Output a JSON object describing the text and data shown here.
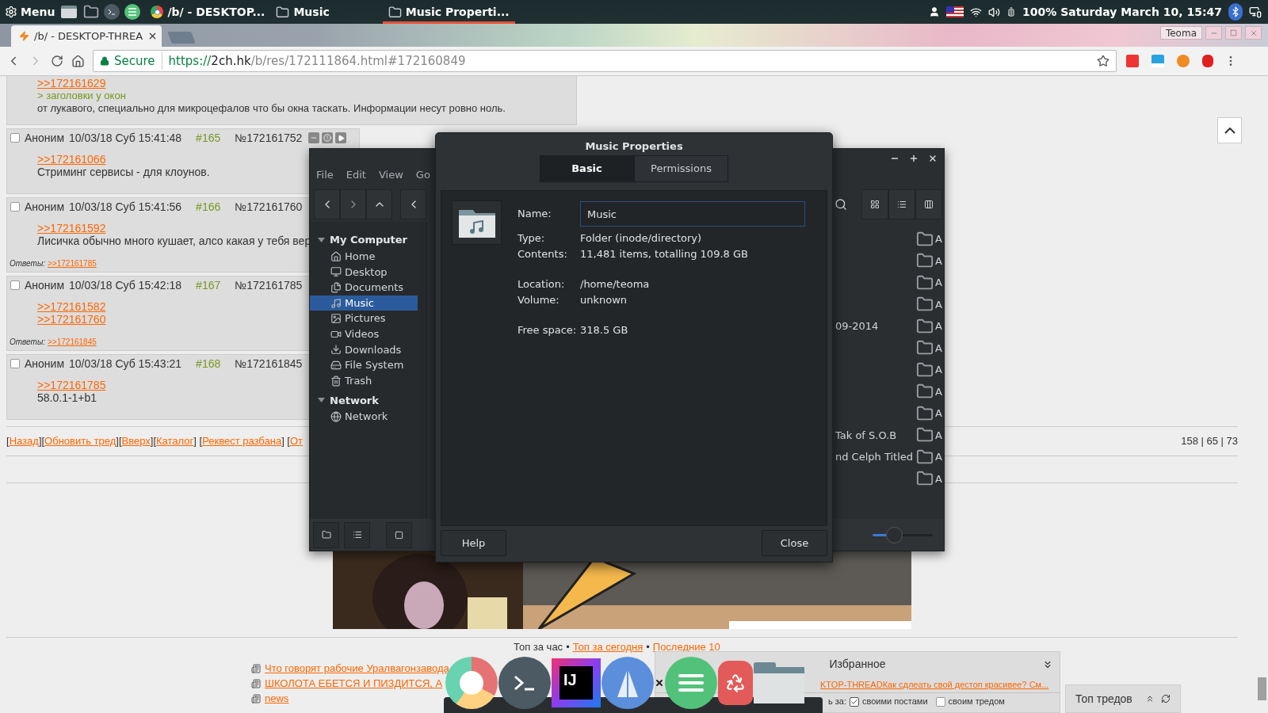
{
  "panel": {
    "menu_label": "Menu",
    "tasks": [
      {
        "label": "/b/ - DESKTOP...",
        "kind": "chrome",
        "selected": false
      },
      {
        "label": "Music",
        "kind": "folder",
        "selected": false
      },
      {
        "label": "Music Properti...",
        "kind": "folder",
        "selected": true
      }
    ],
    "status": "100% Saturday March 10, 15:47"
  },
  "browser": {
    "tab": {
      "title": "/b/ - DESKTOP-THREA"
    },
    "profile": "Teoma",
    "address": {
      "secure_label": "Secure",
      "scheme": "https://",
      "host": "2ch.hk",
      "path": "/b/res/172111864.html#172160849"
    }
  },
  "thread": {
    "partial_post": {
      "link": ">>172161629",
      "quote": "> заголовки у окон",
      "text": "от лукавого, специально для микроцефалов что бы окна таскать. Информации несут ровно ноль."
    },
    "posts": [
      {
        "checked": false,
        "author": "Аноним",
        "date": "10/03/18 Суб 15:41:48",
        "num": "#165",
        "id": "№172161752",
        "actions": true,
        "links": [
          ">>172161066"
        ],
        "text": "Стриминг сервисы - для клоунов."
      },
      {
        "checked": false,
        "author": "Аноним",
        "date": "10/03/18 Суб 15:41:56",
        "num": "#166",
        "id": "№172161760",
        "actions": false,
        "links": [
          ">>172161592"
        ],
        "text": "Лисичка обычно много кушает, алсо какая у тебя вер",
        "replies_label": "Ответы:",
        "reply": ">>172161785"
      },
      {
        "checked": false,
        "author": "Аноним",
        "date": "10/03/18 Суб 15:42:18",
        "num": "#167",
        "id": "№172161785",
        "actions": false,
        "links": [
          ">>172161582",
          ">>172161760"
        ],
        "replies_label": "Ответы:",
        "reply": ">>172161845"
      },
      {
        "checked": false,
        "author": "Аноним",
        "date": "10/03/18 Суб 15:43:21",
        "num": "#168",
        "id": "№172161845",
        "actions": false,
        "links": [
          ">>172161785"
        ],
        "text": "58.0.1-1+b1"
      }
    ],
    "nav": [
      {
        "kind": "text",
        "text": "["
      },
      {
        "kind": "link",
        "text": "Назад"
      },
      {
        "kind": "text",
        "text": "]["
      },
      {
        "kind": "link",
        "text": "Обновить тред"
      },
      {
        "kind": "text",
        "text": "]["
      },
      {
        "kind": "link",
        "text": "Вверх"
      },
      {
        "kind": "text",
        "text": "]["
      },
      {
        "kind": "link",
        "text": "Каталог"
      },
      {
        "kind": "text",
        "text": "] ["
      },
      {
        "kind": "link",
        "text": "Реквест разбана"
      },
      {
        "kind": "text",
        "text": "] ["
      },
      {
        "kind": "link",
        "text": "От"
      }
    ],
    "counts": "158 | 65 | 73",
    "top_links": [
      {
        "kind": "text",
        "text": "Топ за час"
      },
      {
        "kind": "text",
        "text": "•"
      },
      {
        "kind": "link",
        "text": "Топ за сегодня"
      },
      {
        "kind": "text",
        "text": "•"
      },
      {
        "kind": "link",
        "text": "Последние 10"
      }
    ],
    "news": [
      "Что говорят рабочие Уралвагонзавода",
      "ШКОЛОТА ЕБЕТСЯ И ПИЗДИТСЯ, А",
      "news"
    ]
  },
  "favorites": {
    "title": "Избранное",
    "entry": "KTOP-THREADКак сдлеать свой дестоп красивее? См...",
    "options_label": "ь за:",
    "options": [
      {
        "label": "своими постами",
        "checked": true
      },
      {
        "label": "своим тредом",
        "checked": false
      }
    ]
  },
  "top_threads": {
    "title": "Топ тредов"
  },
  "file_manager": {
    "menu": [
      "File",
      "Edit",
      "View",
      "Go"
    ],
    "sidebar": [
      {
        "label": "My Computer",
        "expanded": true,
        "children": [
          {
            "label": "Home",
            "kind": "home",
            "selected": false
          },
          {
            "label": "Desktop",
            "kind": "desktop",
            "selected": false
          },
          {
            "label": "Documents",
            "kind": "documents",
            "selected": false
          },
          {
            "label": "Music",
            "kind": "music",
            "selected": true
          },
          {
            "label": "Pictures",
            "kind": "pictures",
            "selected": false
          },
          {
            "label": "Videos",
            "kind": "videos",
            "selected": false
          },
          {
            "label": "Downloads",
            "kind": "downloads",
            "selected": false
          },
          {
            "label": "File System",
            "kind": "drive",
            "selected": false
          },
          {
            "label": "Trash",
            "kind": "trash",
            "selected": false
          }
        ]
      },
      {
        "label": "Network",
        "expanded": true,
        "children": [
          {
            "label": "Network",
            "kind": "network",
            "selected": false
          }
        ]
      }
    ],
    "rows": [
      {
        "right": "A"
      },
      {
        "right": "A"
      },
      {
        "right": "A"
      },
      {
        "right": "A"
      },
      {
        "left": "09-2014",
        "right": "A"
      },
      {
        "right": "A"
      },
      {
        "right": "A"
      },
      {
        "right": "A"
      },
      {
        "right": "A"
      },
      {
        "left": "Tak of S.O.B",
        "right": "A"
      },
      {
        "left": "nd Celph Titled",
        "right": "A"
      },
      {
        "right": "A"
      }
    ],
    "zoom": {
      "level": 0.35
    }
  },
  "dialog": {
    "title": "Music Properties",
    "tabs": [
      {
        "label": "Basic",
        "selected": true
      },
      {
        "label": "Permissions",
        "selected": false
      }
    ],
    "name_label": "Name:",
    "name_value": "Music",
    "groups": [
      [
        {
          "label": "Type:",
          "value": "Folder (inode/directory)"
        },
        {
          "label": "Contents:",
          "value": "11,481 items, totalling 109.8 GB"
        }
      ],
      [
        {
          "label": "Location:",
          "value": "/home/teoma"
        },
        {
          "label": "Volume:",
          "value": "unknown"
        }
      ],
      [
        {
          "label": "Free space:",
          "value": "318.5 GB"
        }
      ]
    ],
    "buttons": [
      "Help",
      "Close"
    ]
  },
  "dock": [
    {
      "kind": "chrome"
    },
    {
      "kind": "terminal"
    },
    {
      "kind": "ide",
      "label": "IJ"
    },
    {
      "kind": "compass"
    },
    {
      "kind": "close"
    },
    {
      "kind": "menu"
    },
    {
      "kind": "recycle"
    },
    {
      "kind": "folder"
    }
  ]
}
